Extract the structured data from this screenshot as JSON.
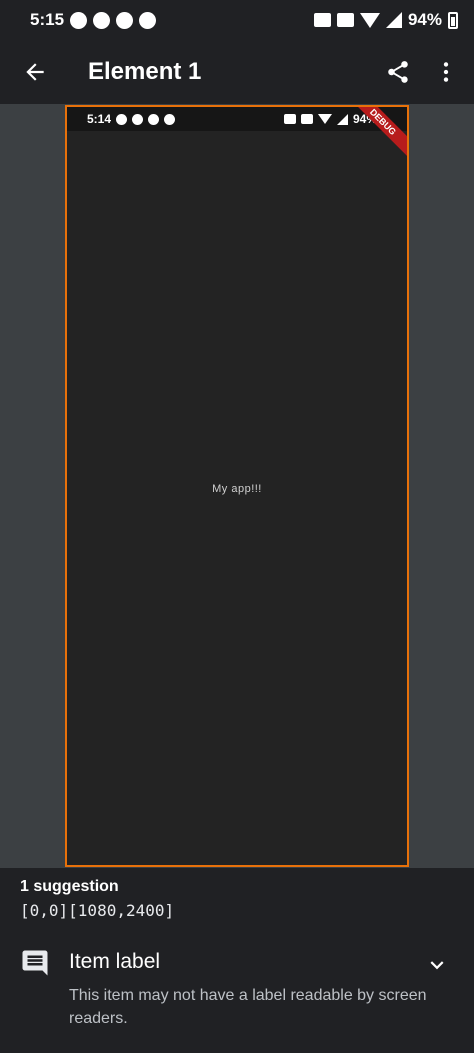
{
  "statusbar": {
    "time": "5:15",
    "battery": "94%"
  },
  "appbar": {
    "title": "Element 1"
  },
  "preview": {
    "status_time": "5:14",
    "status_battery": "94%",
    "debug_banner": "DEBUG",
    "app_text": "My app!!!"
  },
  "suggestions": {
    "title": "1 suggestion",
    "bounds": "[0,0][1080,2400]",
    "item": {
      "label": "Item label",
      "description": "This item may not have a label readable by screen readers."
    }
  },
  "colors": {
    "highlight": "#e8710a",
    "background": "#202124",
    "preview_bg": "#3c4043"
  }
}
